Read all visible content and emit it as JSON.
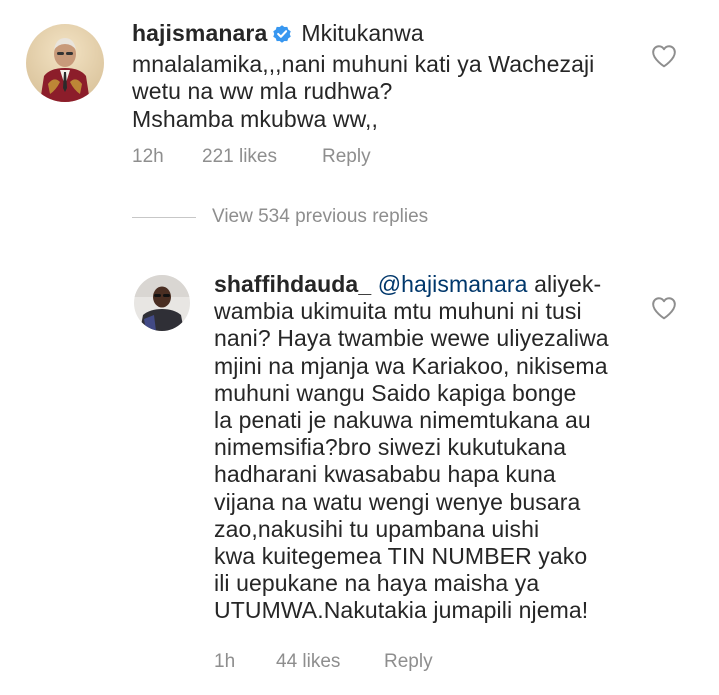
{
  "comment": {
    "username": "hajismanara",
    "text_line1": "Mkitukanwa",
    "text_rest": [
      "mnalalamika,,,nani muhuni kati ya Wachezaji",
      "wetu na ww mla rudhwa?",
      "Mshamba mkubwa ww,,"
    ],
    "time": "12h",
    "likes": "221 likes",
    "reply_label": "Reply"
  },
  "view_replies": {
    "label": "View 534 previous replies"
  },
  "reply": {
    "username": "shaffihdauda_",
    "mention": "@hajismanara",
    "text_line1": "aliyek-",
    "text_rest": [
      "wambia ukimuita mtu muhuni ni tusi",
      "nani? Haya twambie wewe uliyezaliwa",
      "mjini na mjanja wa Kariakoo, nikisema",
      "muhuni wangu Saido kapiga bonge",
      "la penati je nakuwa nimemtukana au",
      "nimemsifia?bro siwezi kukutukana",
      "hadharani kwasababu hapa kuna",
      "vijana na watu wengi wenye busara",
      "zao,nakusihi tu upambana uishi",
      "kwa kuitegemea TIN NUMBER yako",
      "ili uepukane na haya maisha ya",
      "UTUMWA.Nakutakia jumapili njema!"
    ],
    "time": "1h",
    "likes": "44 likes",
    "reply_label": "Reply"
  },
  "icons": {
    "verified_badge": "verified-badge-icon",
    "like": "heart-outline-icon"
  },
  "colors": {
    "text": "#262626",
    "secondary": "#8e8e8e",
    "mention": "#00376b",
    "verified": "#3897f0"
  }
}
